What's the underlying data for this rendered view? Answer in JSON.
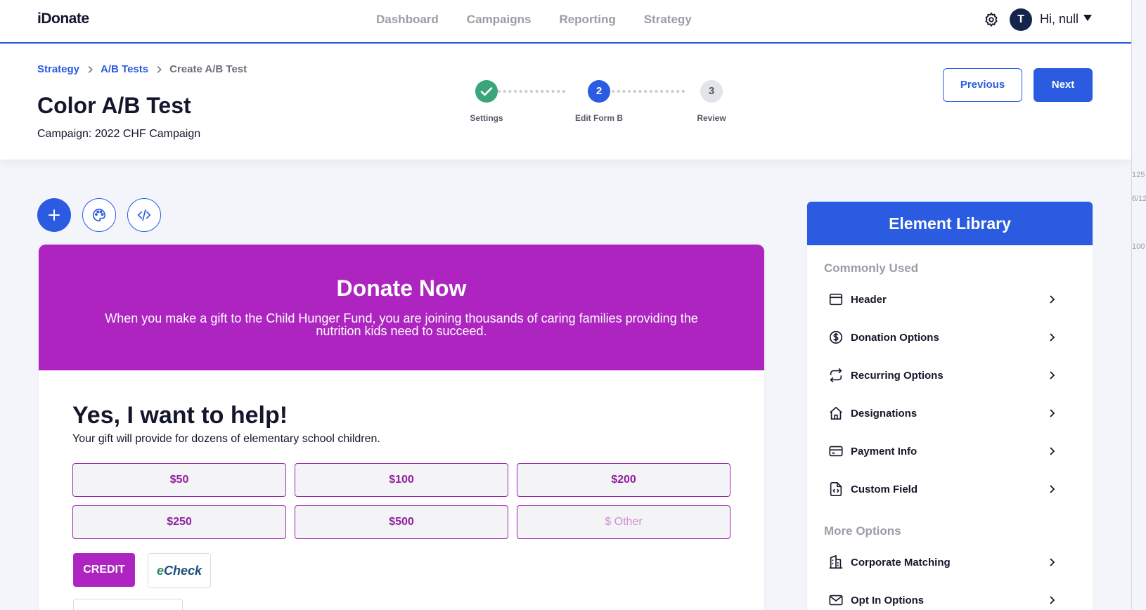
{
  "app": {
    "logo": "iDonate"
  },
  "nav": {
    "links": [
      "Dashboard",
      "Campaigns",
      "Reporting",
      "Strategy"
    ],
    "avatar_initial": "T",
    "greeting": "Hi, null"
  },
  "breadcrumb": {
    "items": [
      "Strategy",
      "A/B Tests"
    ],
    "current": "Create A/B Test"
  },
  "page": {
    "title": "Color A/B Test",
    "campaign_label": "Campaign:",
    "campaign_name": "2022 CHF Campaign"
  },
  "stepper": {
    "steps": [
      {
        "number": "",
        "label": "Settings",
        "state": "complete"
      },
      {
        "number": "2",
        "label": "Edit Form B",
        "state": "active"
      },
      {
        "number": "3",
        "label": "Review",
        "state": "upcoming"
      }
    ]
  },
  "actions": {
    "previous": "Previous",
    "next": "Next"
  },
  "form": {
    "banner_title": "Donate Now",
    "banner_text": "When you make a gift to the Child Hunger Fund, you are joining thousands of caring families providing the nutrition kids need to succeed.",
    "heading": "Yes, I want to help!",
    "subheading": "Your gift will provide for dozens of elementary school children.",
    "amounts": [
      "$50",
      "$100",
      "$200",
      "$250",
      "$500"
    ],
    "other_placeholder": "$ Other",
    "payment_credit": "CREDIT",
    "payment_echeck_e": "e",
    "payment_echeck_rest": "Check"
  },
  "library": {
    "title": "Element Library",
    "section_common": "Commonly Used",
    "common_items": [
      "Header",
      "Donation Options",
      "Recurring Options",
      "Designations",
      "Payment Info",
      "Custom Field"
    ],
    "section_more": "More Options",
    "more_items": [
      "Corporate Matching",
      "Opt In Options"
    ]
  },
  "edge_fragments": [
    "125",
    "6/12",
    "100"
  ],
  "colors": {
    "primary": "#2a5be0",
    "form_accent": "#ad24c0",
    "success": "#3aa57a",
    "avatar": "#14254d"
  }
}
